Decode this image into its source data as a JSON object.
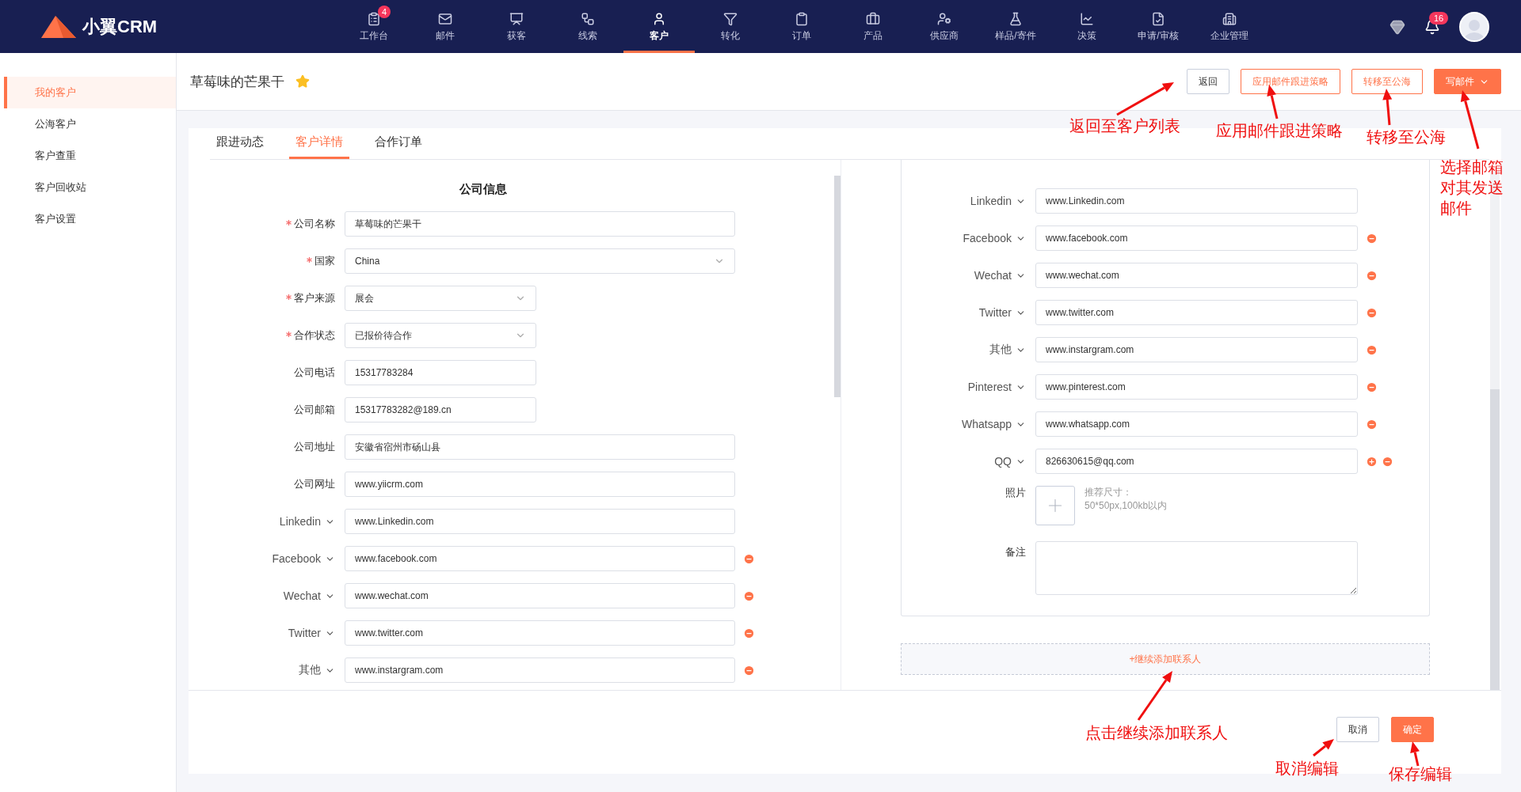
{
  "brand": {
    "name": "小翼CRM"
  },
  "nav": {
    "items": [
      {
        "label": "工作台",
        "selected": false,
        "badge": "4"
      },
      {
        "label": "邮件",
        "selected": false
      },
      {
        "label": "获客",
        "selected": false
      },
      {
        "label": "线索",
        "selected": false
      },
      {
        "label": "客户",
        "selected": true
      },
      {
        "label": "转化",
        "selected": false
      },
      {
        "label": "订单",
        "selected": false
      },
      {
        "label": "产品",
        "selected": false
      },
      {
        "label": "供应商",
        "selected": false
      },
      {
        "label": "样品/寄件",
        "selected": false
      },
      {
        "label": "决策",
        "selected": false
      },
      {
        "label": "申请/审核",
        "selected": false
      },
      {
        "label": "企业管理",
        "selected": false
      }
    ],
    "notification_badge": "16"
  },
  "sidebar": {
    "items": [
      {
        "label": "我的客户",
        "selected": true
      },
      {
        "label": "公海客户",
        "selected": false
      },
      {
        "label": "客户查重",
        "selected": false
      },
      {
        "label": "客户回收站",
        "selected": false
      },
      {
        "label": "客户设置",
        "selected": false
      }
    ]
  },
  "header": {
    "title": "草莓味的芒果干",
    "starred": true,
    "buttons": [
      {
        "label": "返回",
        "kind": "plain"
      },
      {
        "label": "应用邮件跟进策略",
        "kind": "outline"
      },
      {
        "label": "转移至公海",
        "kind": "outline"
      },
      {
        "label": "写邮件",
        "kind": "primary"
      }
    ]
  },
  "tabs": [
    {
      "label": "跟进动态",
      "selected": false
    },
    {
      "label": "客户详情",
      "selected": true
    },
    {
      "label": "合作订单",
      "selected": false
    }
  ],
  "company": {
    "title": "公司信息",
    "fields": [
      {
        "kind": "text",
        "label": "公司名称",
        "required": true,
        "value": "草莓味的芒果干"
      },
      {
        "kind": "select",
        "label": "国家",
        "required": true,
        "value": "China"
      },
      {
        "kind": "select",
        "label": "客户来源",
        "required": true,
        "value": "展会"
      },
      {
        "kind": "select",
        "label": "合作状态",
        "required": true,
        "value": "已报价待合作"
      },
      {
        "kind": "text",
        "label": "公司电话",
        "required": false,
        "value": "15317783284"
      },
      {
        "kind": "text",
        "label": "公司邮箱",
        "required": false,
        "value": "15317783282@189.cn"
      },
      {
        "kind": "text",
        "label": "公司地址",
        "required": false,
        "value": "安徽省宿州市砀山县"
      },
      {
        "kind": "text",
        "label": "公司网址",
        "required": false,
        "value": "www.yiicrm.com"
      },
      {
        "kind": "social",
        "label": "Linkedin",
        "value": "www.Linkedin.com",
        "removable": false
      },
      {
        "kind": "social",
        "label": "Facebook",
        "value": "www.facebook.com",
        "removable": true
      },
      {
        "kind": "social",
        "label": "Wechat",
        "value": "www.wechat.com",
        "removable": true
      },
      {
        "kind": "social",
        "label": "Twitter",
        "value": "www.twitter.com",
        "removable": true
      },
      {
        "kind": "social",
        "label": "其他",
        "value": "www.instargram.com",
        "removable": true
      }
    ]
  },
  "contact": {
    "fields": [
      {
        "kind": "social",
        "label": "Linkedin",
        "value": "www.Linkedin.com",
        "removable": false,
        "addable": false
      },
      {
        "kind": "social",
        "label": "Facebook",
        "value": "www.facebook.com",
        "removable": true,
        "addable": false
      },
      {
        "kind": "social",
        "label": "Wechat",
        "value": "www.wechat.com",
        "removable": true,
        "addable": false
      },
      {
        "kind": "social",
        "label": "Twitter",
        "value": "www.twitter.com",
        "removable": true,
        "addable": false
      },
      {
        "kind": "social",
        "label": "其他",
        "value": "www.instargram.com",
        "removable": true,
        "addable": false
      },
      {
        "kind": "social",
        "label": "Pinterest",
        "value": "www.pinterest.com",
        "removable": true,
        "addable": false
      },
      {
        "kind": "social",
        "label": "Whatsapp",
        "value": "www.whatsapp.com",
        "removable": true,
        "addable": false
      },
      {
        "kind": "social",
        "label": "QQ",
        "value": "826630615@qq.com",
        "removable": true,
        "addable": true
      },
      {
        "kind": "photo",
        "label": "照片",
        "hint": [
          "推荐尺寸：",
          "50*50px,100kb以内"
        ]
      },
      {
        "kind": "notes",
        "label": "备注"
      }
    ],
    "add_link": "+继续添加联系人"
  },
  "footer": {
    "buttons": [
      {
        "label": "取消",
        "kind": "plain"
      },
      {
        "label": "确定",
        "kind": "primary"
      }
    ]
  },
  "annotations": [
    {
      "lines": [
        "返回至客户列表"
      ]
    },
    {
      "lines": [
        "应用邮件跟进策略"
      ]
    },
    {
      "lines": [
        "转移至公海"
      ]
    },
    {
      "lines": [
        "选择邮箱",
        "对其发送",
        "邮件"
      ]
    },
    {
      "lines": [
        "点击继续添加联系人"
      ]
    },
    {
      "lines": [
        "取消编辑"
      ]
    },
    {
      "lines": [
        "保存编辑"
      ]
    }
  ]
}
